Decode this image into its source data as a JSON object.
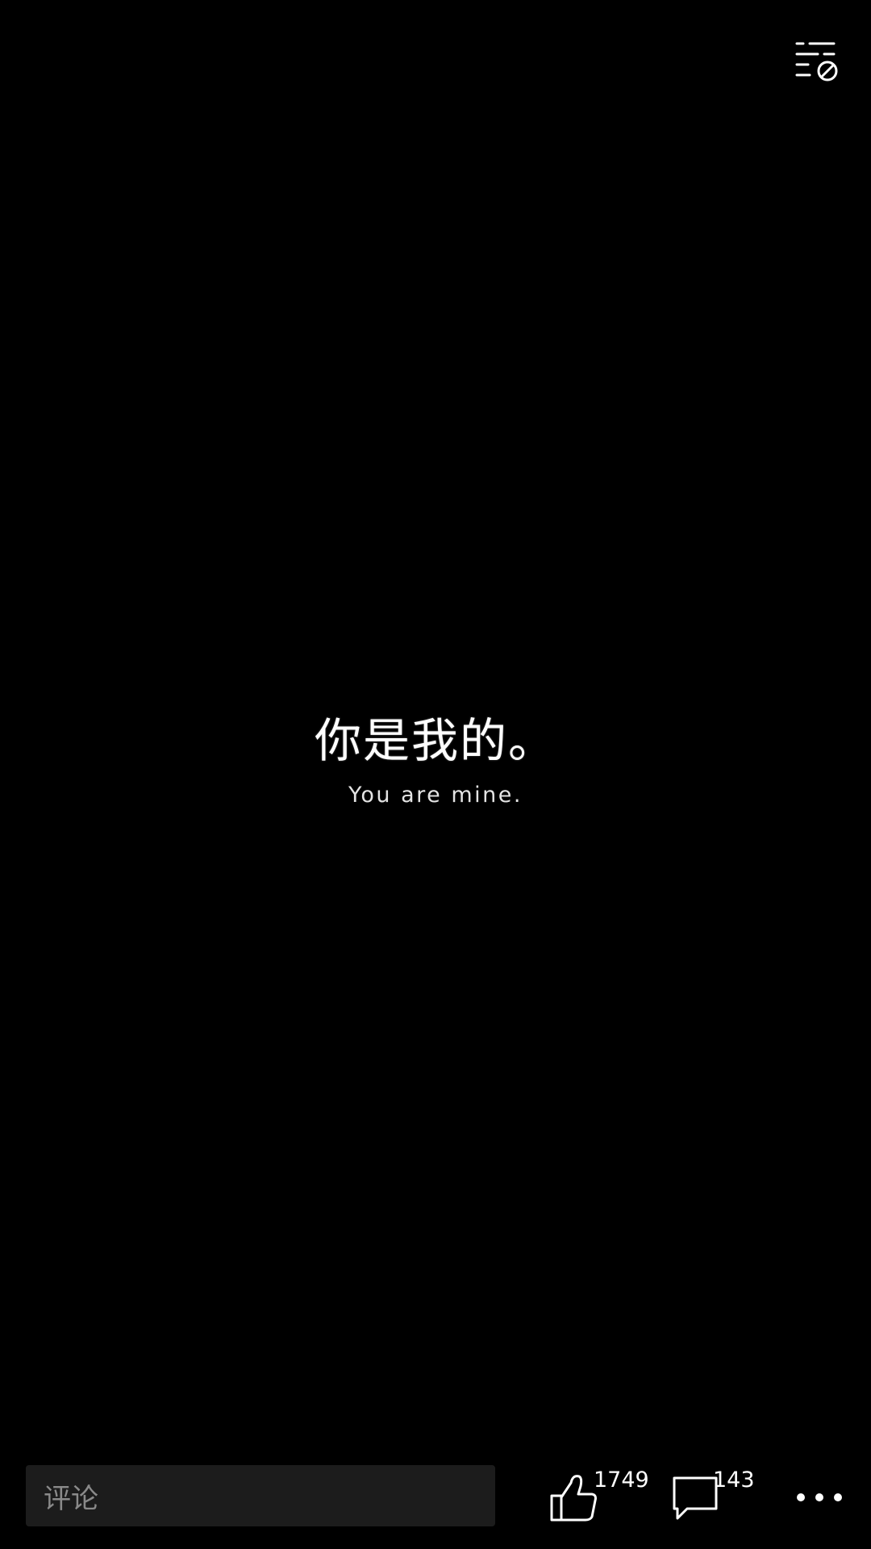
{
  "post": {
    "title_cn": "你是我的。",
    "subtitle_en": "You are mine."
  },
  "toolbar": {
    "filter_icon": "list-block-icon"
  },
  "bottom_bar": {
    "comment_placeholder": "评论",
    "like_count": "1749",
    "comment_count": "143",
    "more_icon": "more-horizontal-icon"
  },
  "colors": {
    "background": "#000000",
    "text": "#ffffff",
    "input_bg": "#1c1c1c",
    "placeholder": "#8a8a8a"
  }
}
